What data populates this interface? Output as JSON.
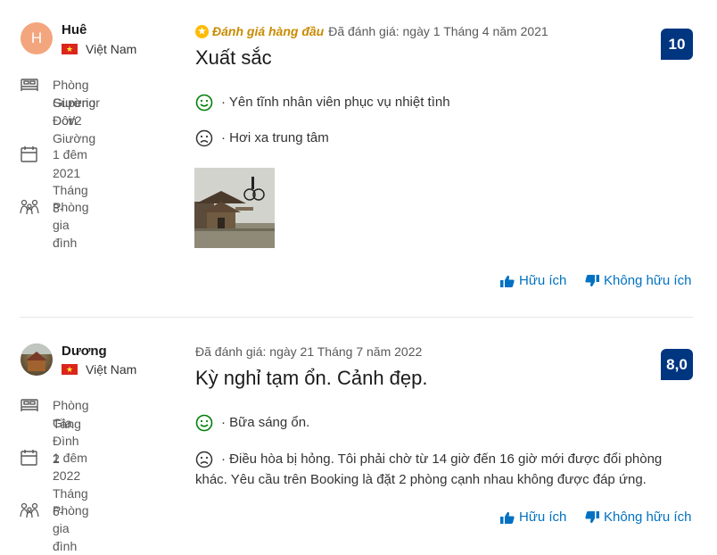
{
  "reviews": [
    {
      "avatar_letter": "H",
      "name": "Huê",
      "country": "Việt Nam",
      "room": [
        "Phòng Superior",
        "Giường Đôi/2 Giường",
        "Đơn"
      ],
      "stay": [
        "1 đêm ·  Tháng 3-",
        "2021"
      ],
      "group": "Phòng gia đình",
      "top_badge": "Đánh giá hàng đầu",
      "date": "Đã đánh giá: ngày 1 Tháng 4 năm 2021",
      "title": "Xuất sắc",
      "score": "10",
      "positive": "· Yên tĩnh nhân viên phục vụ nhiệt tình",
      "negative": "· Hơi xa trung tâm",
      "helpful": "Hữu ích",
      "not_helpful": "Không hữu ích"
    },
    {
      "name": "Dương",
      "country": "Việt Nam",
      "room": [
        "Phòng Gia Đình 2",
        "Tầng"
      ],
      "stay": [
        "1 đêm ·  Tháng 6-",
        "2022"
      ],
      "group": "Phòng gia đình",
      "date": "Đã đánh giá: ngày 21 Tháng 7 năm 2022",
      "title": "Kỳ nghỉ tạm ổn. Cảnh đẹp.",
      "score": "8,0",
      "positive": "· Bữa sáng ổn.",
      "negative": [
        "· Điều hòa bị hỏng. Tôi phải chờ từ 14 giờ đến 16 giờ mới được đổi phòng",
        "khác. Yêu cầu trên Booking là đặt 2 phòng cạnh nhau không được đáp ứng."
      ],
      "helpful": "Hữu ích",
      "not_helpful": "Không hữu ích"
    }
  ],
  "colors": {
    "score_bg": "#003580",
    "link": "#0071c2",
    "positive": "#008009",
    "top_badge": "#febb02"
  }
}
